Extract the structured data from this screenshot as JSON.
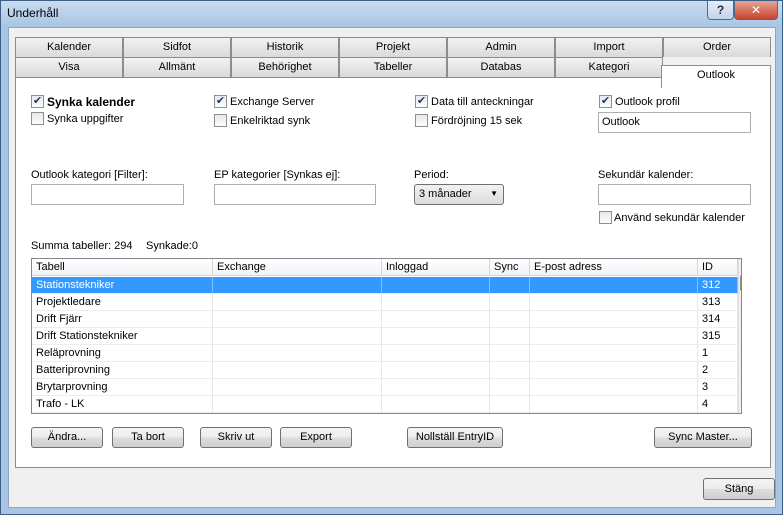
{
  "window": {
    "title": "Underhåll",
    "help_label": "?",
    "close_label": "✕"
  },
  "tabs": {
    "row1": [
      "Kalender",
      "Sidfot",
      "Historik",
      "Projekt",
      "Admin",
      "Import",
      "Order"
    ],
    "row2": [
      "Visa",
      "Allmänt",
      "Behörighet",
      "Tabeller",
      "Databas",
      "Kategori",
      "Outlook"
    ],
    "active": "Outlook"
  },
  "options": {
    "synka_kalender": {
      "label": "Synka kalender",
      "checked": true
    },
    "synka_uppgifter": {
      "label": "Synka uppgifter",
      "checked": false
    },
    "exchange_server": {
      "label": "Exchange Server",
      "checked": true
    },
    "enkelriktad_synk": {
      "label": "Enkelriktad synk",
      "checked": false
    },
    "data_till_anteckningar": {
      "label": "Data till anteckningar",
      "checked": true
    },
    "fordrojning": {
      "label": "Fördröjning 15 sek",
      "checked": false
    },
    "outlook_profil": {
      "label": "Outlook profil",
      "checked": true,
      "value": "Outlook"
    }
  },
  "filters": {
    "outlook_kategori_label": "Outlook kategori [Filter]:",
    "outlook_kategori_value": "",
    "ep_kategorier_label": "EP kategorier [Synkas ej]:",
    "ep_kategorier_value": "",
    "period_label": "Period:",
    "period_value": "3 månader",
    "sekundar_label": "Sekundär kalender:",
    "sekundar_value": "",
    "anvand_sekundar": {
      "label": "Använd sekundär kalender",
      "checked": false
    }
  },
  "summary": {
    "summa": "Summa tabeller: 294",
    "synkade": "Synkade:0"
  },
  "table": {
    "columns": [
      "Tabell",
      "Exchange",
      "Inloggad",
      "Sync",
      "E-post adress",
      "ID"
    ],
    "rows": [
      {
        "tabell": "Stationstekniker",
        "exchange": "",
        "inloggad": "",
        "sync": "",
        "epost": "",
        "id": "312",
        "selected": true
      },
      {
        "tabell": "Projektledare",
        "exchange": "",
        "inloggad": "",
        "sync": "",
        "epost": "",
        "id": "313",
        "selected": false
      },
      {
        "tabell": "Drift Fjärr",
        "exchange": "",
        "inloggad": "",
        "sync": "",
        "epost": "",
        "id": "314",
        "selected": false
      },
      {
        "tabell": "Drift Stationstekniker",
        "exchange": "",
        "inloggad": "",
        "sync": "",
        "epost": "",
        "id": "315",
        "selected": false
      },
      {
        "tabell": "Reläprovning",
        "exchange": "",
        "inloggad": "",
        "sync": "",
        "epost": "",
        "id": "1",
        "selected": false
      },
      {
        "tabell": "Batteriprovning",
        "exchange": "",
        "inloggad": "",
        "sync": "",
        "epost": "",
        "id": "2",
        "selected": false
      },
      {
        "tabell": "Brytarprovning",
        "exchange": "",
        "inloggad": "",
        "sync": "",
        "epost": "",
        "id": "3",
        "selected": false
      },
      {
        "tabell": "Trafo - LK",
        "exchange": "",
        "inloggad": "",
        "sync": "",
        "epost": "",
        "id": "4",
        "selected": false
      }
    ]
  },
  "buttons": {
    "andra": "Ändra...",
    "ta_bort": "Ta bort",
    "skriv_ut": "Skriv ut",
    "export": "Export",
    "nollstall": "Nollställ EntryID",
    "sync_master": "Sync Master...",
    "stang": "Stäng"
  },
  "icons": {
    "check": "checkmark-icon",
    "dropdown": "chevron-down-icon",
    "scroll_up": "scroll-up-icon",
    "scroll_down": "scroll-down-icon"
  },
  "colors": {
    "selection": "#3399ff",
    "title_bar": "#a9c5e3",
    "close_button": "#c7442b"
  }
}
